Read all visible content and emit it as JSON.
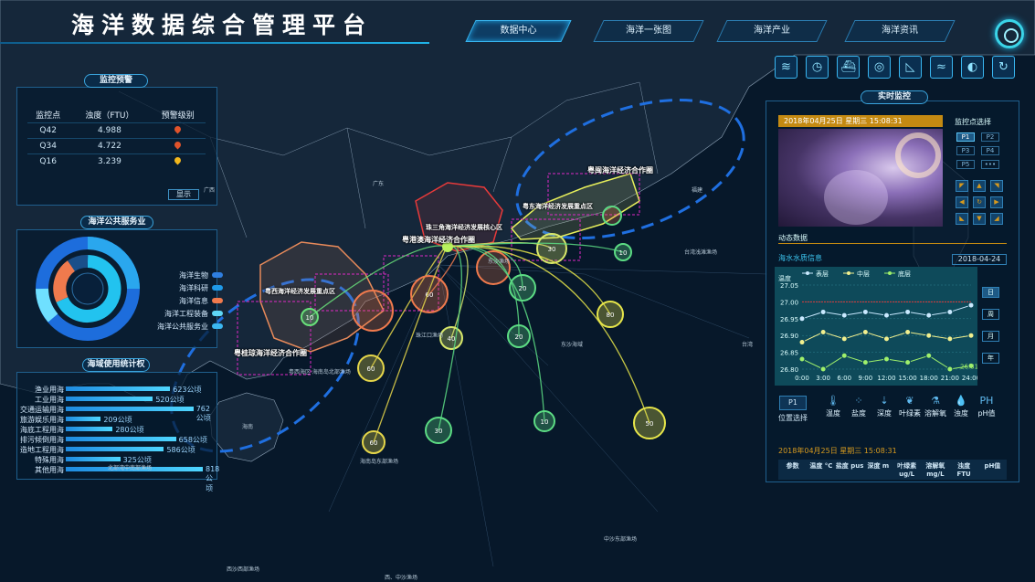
{
  "app": {
    "title": "海洋数据综合管理平台"
  },
  "nav": {
    "tabs": [
      {
        "label": "数据中心",
        "active": true
      },
      {
        "label": "海洋一张图"
      },
      {
        "label": "海洋产业"
      },
      {
        "label": "海洋资讯"
      }
    ]
  },
  "toolbar": {
    "icons": [
      "layers-icon",
      "clock-icon",
      "ship-icon",
      "target-icon",
      "wave-chart-icon",
      "waves-icon",
      "contrast-icon",
      "refresh-icon"
    ],
    "glyphs": [
      "≋",
      "◷",
      "⛴",
      "◎",
      "◺",
      "≈",
      "◐",
      "↻"
    ]
  },
  "monitor_warning": {
    "title": "监控预警",
    "headers": [
      "监控点",
      "浊度（FTU）",
      "预警级别"
    ],
    "rows": [
      {
        "point": "Q42",
        "value": "4.988",
        "level_color": "#e0532b"
      },
      {
        "point": "Q34",
        "value": "4.722",
        "level_color": "#e0532b"
      },
      {
        "point": "Q16",
        "value": "3.239",
        "level_color": "#f2b71c"
      }
    ],
    "show_button": "显示"
  },
  "public_service": {
    "title": "海洋公共服务业",
    "legend": [
      {
        "label": "海洋生物",
        "color": "#2f7fe0"
      },
      {
        "label": "海洋科研",
        "color": "#1f9ae8"
      },
      {
        "label": "海洋信息",
        "color": "#f07a4d"
      },
      {
        "label": "海洋工程装备",
        "color": "#5fd6f5"
      },
      {
        "label": "海洋公共服务业",
        "color": "#3bb7f0"
      }
    ]
  },
  "usage": {
    "title": "海域使用统计权",
    "rows": [
      {
        "label": "渔业用海",
        "value": "623公顷",
        "n": 623
      },
      {
        "label": "工业用海",
        "value": "520公顷",
        "n": 520
      },
      {
        "label": "交通运输用海",
        "value": "762公顷",
        "n": 762
      },
      {
        "label": "旅游娱乐用海",
        "value": "209公顷",
        "n": 209
      },
      {
        "label": "海底工程用海",
        "value": "280公顷",
        "n": 280
      },
      {
        "label": "排污倾倒用海",
        "value": "658公顷",
        "n": 658
      },
      {
        "label": "造地工程用海",
        "value": "586公顷",
        "n": 586
      },
      {
        "label": "特殊用海",
        "value": "325公顷",
        "n": 325
      },
      {
        "label": "其他用海",
        "value": "818公顷",
        "n": 818
      }
    ]
  },
  "map": {
    "zones": [
      "粤闽海洋经济合作圈",
      "粤东海洋经济发展重点区",
      "珠三角海洋经济发展核心区",
      "粤港澳海洋经济合作圈",
      "粤西海洋经济发展重点区",
      "粤桂琼海洋经济合作圈"
    ],
    "places": [
      "广东",
      "广西",
      "海南",
      "福建",
      "台湾浅滩渔场",
      "东沙海域",
      "珠江口渔场",
      "粤西海区·海南岛北部渔场",
      "海南岛东部渔场",
      "中沙东部渔场",
      "西沙西部渔场",
      "北部湾中南部渔场",
      "台湾",
      "东沙渔场",
      "西、中沙渔场"
    ],
    "markers": [
      "30",
      "20",
      "80",
      "60",
      "40",
      "60",
      "10",
      "20",
      "10",
      "60",
      "30",
      "10",
      "50"
    ]
  },
  "realtime": {
    "title": "实时监控",
    "datetime": "2018年04月25日  星期三  15:08:31",
    "point_select_label": "监控点选择",
    "points": [
      "P1",
      "P2",
      "P3",
      "P4",
      "P5",
      "•••"
    ],
    "dynamic_label": "动态数据"
  },
  "water_quality": {
    "title": "海水水质信息",
    "date": "2018-04-24",
    "legend": [
      "表层",
      "中层",
      "底层"
    ],
    "periods": [
      "日",
      "周",
      "月",
      "年"
    ],
    "point": "P1",
    "point_label": "位置选择",
    "params": [
      {
        "label": "温度",
        "glyph": "🌡"
      },
      {
        "label": "盐度",
        "glyph": "⁘"
      },
      {
        "label": "深度",
        "glyph": "⇣"
      },
      {
        "label": "叶绿素",
        "glyph": "❦"
      },
      {
        "label": "溶解氧",
        "glyph": "⚗"
      },
      {
        "label": "浊度",
        "glyph": "💧"
      },
      {
        "label": "pH值",
        "glyph": "PH"
      }
    ],
    "datetime": "2018年04月25日  星期三  15:08:31",
    "table_headers": [
      "参数",
      "温度 °C",
      "盐度 pus",
      "深度 m",
      "叶绿素 ug/L",
      "溶解氧 mg/L",
      "浊度 FTU",
      "pH值"
    ]
  },
  "chart_data": {
    "type": "line",
    "ylabel": "温度",
    "ylim": [
      26.8,
      27.05
    ],
    "yticks": [
      "27.05",
      "27.00",
      "26.95",
      "26.90",
      "26.85",
      "26.80"
    ],
    "x": [
      "0:00",
      "3:00",
      "6:00",
      "9:00",
      "12:00",
      "15:00",
      "18:00",
      "21:00",
      "24:00"
    ],
    "series": [
      {
        "name": "表层",
        "color": "#c9e9ff",
        "values": [
          26.95,
          26.97,
          26.96,
          26.97,
          26.96,
          26.97,
          26.96,
          26.97,
          26.99
        ]
      },
      {
        "name": "中层",
        "color": "#f2f08e",
        "values": [
          26.88,
          26.91,
          26.89,
          26.91,
          26.89,
          26.91,
          26.9,
          26.89,
          26.9
        ]
      },
      {
        "name": "底层",
        "color": "#9ff06b",
        "values": [
          26.83,
          26.8,
          26.84,
          26.82,
          26.83,
          26.82,
          26.84,
          26.8,
          26.81
        ]
      }
    ],
    "end_label": "26.81",
    "threshold": 27.0
  }
}
